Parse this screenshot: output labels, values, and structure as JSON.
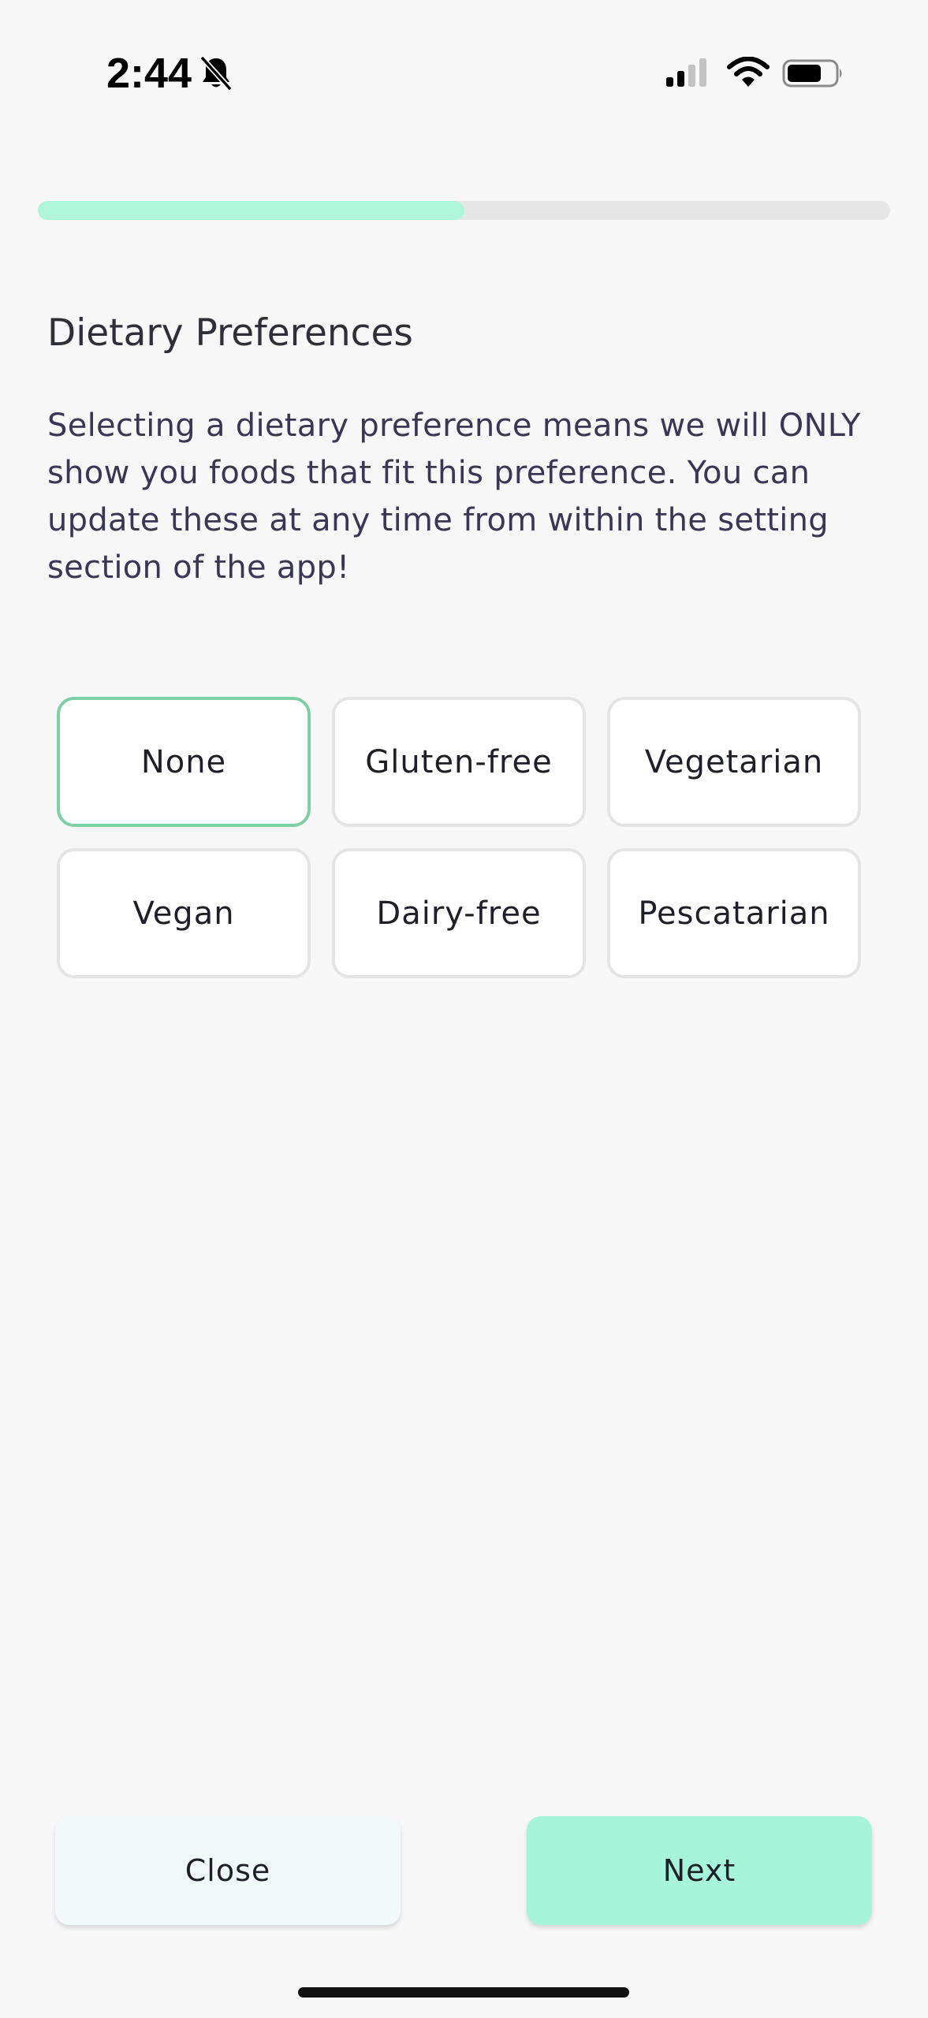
{
  "status_bar": {
    "time": "2:44",
    "icons": [
      "bell-slash-icon",
      "cellular-signal-icon",
      "wifi-icon",
      "battery-icon"
    ]
  },
  "progress": {
    "fraction": 0.5,
    "fill_color": "#aef5dc",
    "track_color": "#e6e6e6"
  },
  "page": {
    "title": "Dietary Preferences",
    "description": "Selecting a dietary preference means we will ONLY show you foods that fit this preference. You can update these at any time from within the setting section of the app!"
  },
  "options": [
    {
      "label": "None",
      "selected": true
    },
    {
      "label": "Gluten-free",
      "selected": false
    },
    {
      "label": "Vegetarian",
      "selected": false
    },
    {
      "label": "Vegan",
      "selected": false
    },
    {
      "label": "Dairy-free",
      "selected": false
    },
    {
      "label": "Pescatarian",
      "selected": false
    }
  ],
  "actions": {
    "close_label": "Close",
    "next_label": "Next"
  },
  "colors": {
    "accent": "#a6f5da",
    "selected_border": "#7fcfa5",
    "text_primary": "#3a3656"
  }
}
